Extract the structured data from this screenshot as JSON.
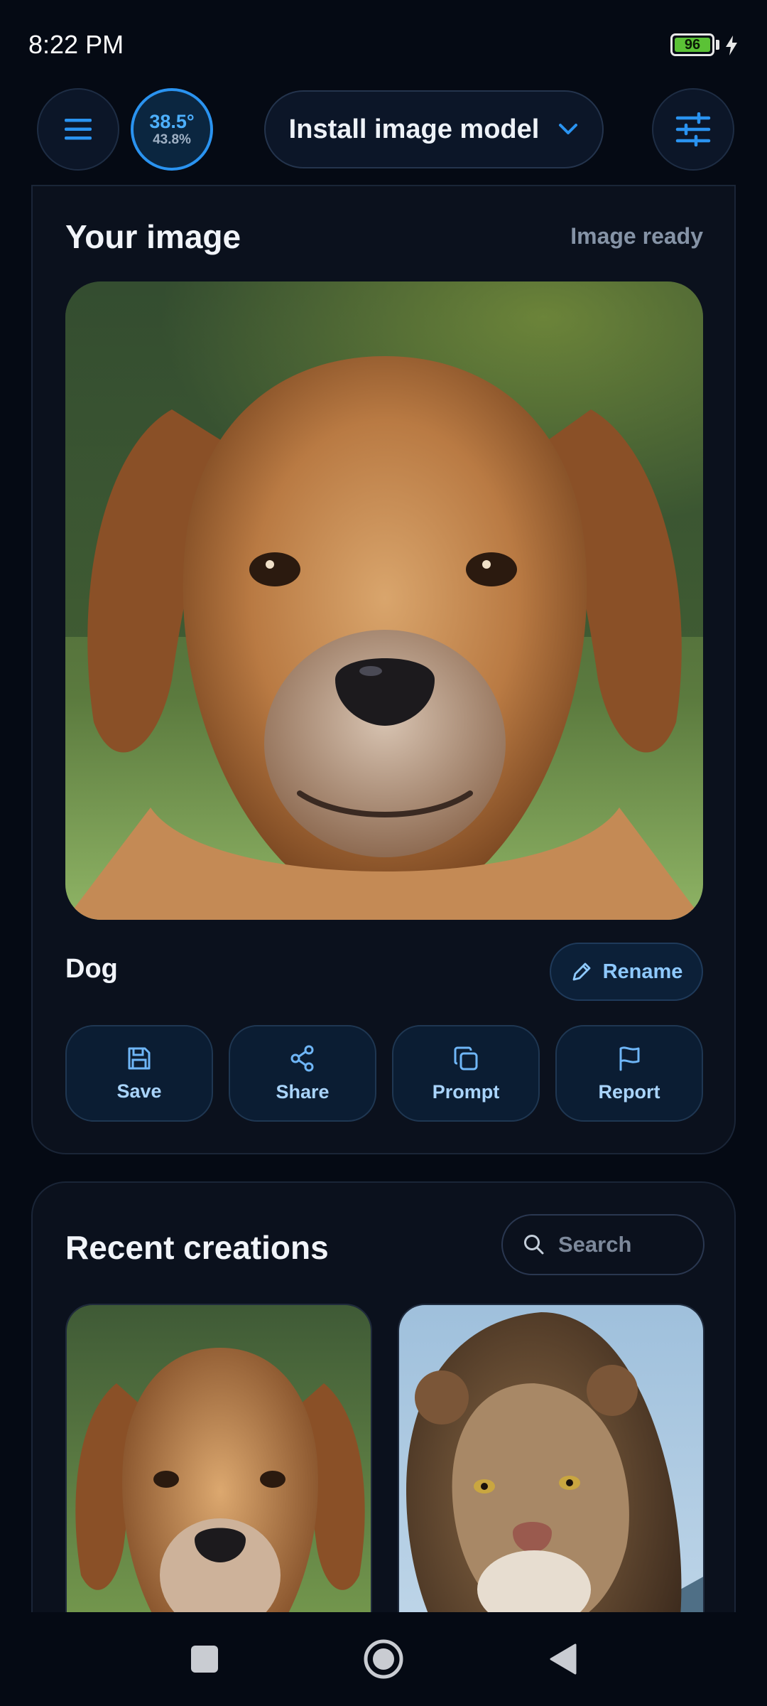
{
  "status_bar": {
    "time": "8:22 PM",
    "battery_level": "96"
  },
  "top_bar": {
    "temperature": "38.5°",
    "usage_percent": "43.8%",
    "model_selector_label": "Install image model"
  },
  "image_card": {
    "title": "Your image",
    "status": "Image ready",
    "image_name": "Dog",
    "rename_label": "Rename",
    "actions": [
      {
        "label": "Save",
        "icon": "save-icon"
      },
      {
        "label": "Share",
        "icon": "share-icon"
      },
      {
        "label": "Prompt",
        "icon": "copy-icon"
      },
      {
        "label": "Report",
        "icon": "flag-icon"
      }
    ]
  },
  "recent": {
    "title": "Recent creations",
    "search_placeholder": "Search",
    "items": [
      "dog-thumbnail",
      "lion-thumbnail"
    ]
  },
  "colors": {
    "accent": "#2a93f0",
    "background": "#050a14",
    "card": "#0b111d"
  }
}
